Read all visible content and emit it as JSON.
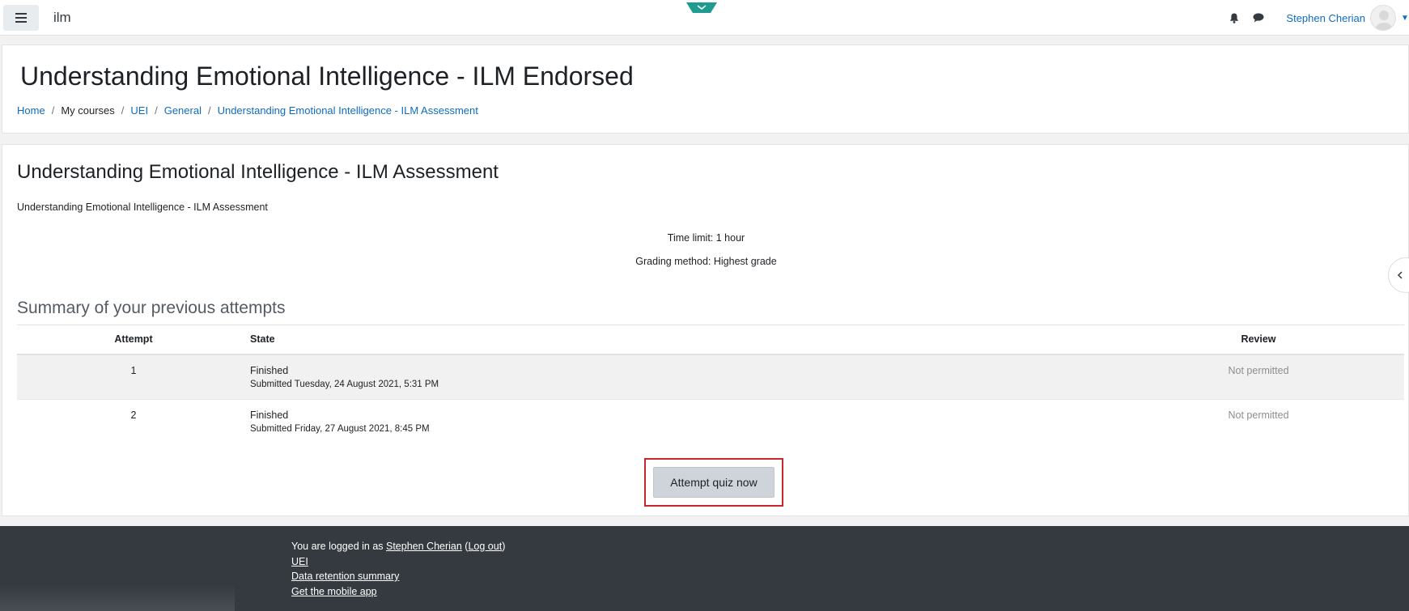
{
  "navbar": {
    "site_name": "ilm",
    "user_name": "Stephen Cherian"
  },
  "header": {
    "course_title": "Understanding Emotional Intelligence - ILM Endorsed",
    "breadcrumb": [
      {
        "label": "Home",
        "link": true
      },
      {
        "label": "My courses",
        "link": false
      },
      {
        "label": "UEI",
        "link": true
      },
      {
        "label": "General",
        "link": true
      },
      {
        "label": "Understanding Emotional Intelligence - ILM Assessment",
        "link": true
      }
    ]
  },
  "quiz": {
    "title": "Understanding Emotional Intelligence - ILM Assessment",
    "intro": "Understanding Emotional Intelligence - ILM Assessment",
    "time_limit": "Time limit: 1 hour",
    "grading_method": "Grading method: Highest grade",
    "summary_heading": "Summary of your previous attempts",
    "table": {
      "headers": [
        "Attempt",
        "State",
        "Review"
      ],
      "rows": [
        {
          "attempt": "1",
          "state": "Finished",
          "submitted": "Submitted Tuesday, 24 August 2021, 5:31 PM",
          "review": "Not permitted"
        },
        {
          "attempt": "2",
          "state": "Finished",
          "submitted": "Submitted Friday, 27 August 2021, 8:45 PM",
          "review": "Not permitted"
        }
      ]
    },
    "attempt_button": "Attempt quiz now"
  },
  "footer": {
    "logged_in_prefix": "You are logged in as ",
    "user_link": "Stephen Cherian",
    "logout_open": " (",
    "logout_link": "Log out",
    "logout_close": ")",
    "links": [
      "UEI",
      "Data retention summary",
      "Get the mobile app"
    ]
  },
  "icons": {
    "menu": "hamburger-icon",
    "notifications": "bell-icon",
    "messages": "chat-bubble-icon",
    "avatar": "user-avatar-icon",
    "drawer": "chevron-left-icon",
    "top_drawer": "chevron-down-icon"
  },
  "colors": {
    "link": "#0f6cbf",
    "footer_bg": "#343a40",
    "highlight_border": "#c6262e",
    "drawer_tab": "#1f9b8f"
  }
}
